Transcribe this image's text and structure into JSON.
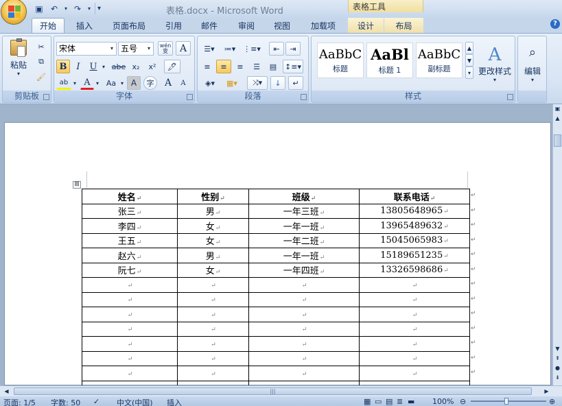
{
  "window": {
    "title": "表格.docx - Microsoft Word",
    "context_tools": "表格工具"
  },
  "tabs": [
    {
      "label": "开始",
      "active": true
    },
    {
      "label": "插入"
    },
    {
      "label": "页面布局"
    },
    {
      "label": "引用"
    },
    {
      "label": "邮件"
    },
    {
      "label": "审阅"
    },
    {
      "label": "视图"
    },
    {
      "label": "加载项"
    },
    {
      "label": "设计",
      "context": true
    },
    {
      "label": "布局",
      "context": true
    }
  ],
  "help": "?",
  "ribbon": {
    "clipboard": {
      "label": "剪贴板",
      "paste": "粘贴"
    },
    "font": {
      "label": "字体",
      "font_name": "宋体",
      "font_size": "五号",
      "wen": "wén\n变",
      "a_box": "A",
      "bold": "B",
      "italic": "I",
      "underline": "U",
      "strike": "abe",
      "sub": "x₂",
      "sup": "x²",
      "highlight": "ab",
      "font_color": "A",
      "case": "Aa",
      "shade": "A",
      "circle": "字",
      "grow": "A",
      "shrink": "A"
    },
    "paragraph": {
      "label": "段落"
    },
    "styles": {
      "label": "样式",
      "items": [
        {
          "sample": "AaBbC",
          "name": "标题"
        },
        {
          "sample": "AaBl",
          "name": "标题 1"
        },
        {
          "sample": "AaBbC",
          "name": "副标题"
        }
      ],
      "change": "更改样式"
    },
    "editing": {
      "label": "编辑"
    }
  },
  "table": {
    "headers": [
      "姓名",
      "性别",
      "班级",
      "联系电话"
    ],
    "rows": [
      [
        "张三",
        "男",
        "一年三班",
        "13805648965"
      ],
      [
        "李四",
        "女",
        "一年一班",
        "13965489632"
      ],
      [
        "王五",
        "女",
        "一年二班",
        "15045065983"
      ],
      [
        "赵六",
        "男",
        "一年一班",
        "15189651235"
      ],
      [
        "阮七",
        "女",
        "一年四班",
        "13326598686"
      ],
      [
        "",
        "",
        "",
        ""
      ],
      [
        "",
        "",
        "",
        ""
      ],
      [
        "",
        "",
        "",
        ""
      ],
      [
        "",
        "",
        "",
        ""
      ],
      [
        "",
        "",
        "",
        ""
      ],
      [
        "",
        "",
        "",
        ""
      ],
      [
        "",
        "",
        "",
        ""
      ],
      [
        "",
        "",
        "",
        ""
      ]
    ],
    "para_mark": "↵",
    "handle": "⊞"
  },
  "status": {
    "page": "页面: 1/5",
    "words": "字数: 50",
    "lang": "中文(中国)",
    "mode": "插入",
    "zoom": "100%"
  }
}
